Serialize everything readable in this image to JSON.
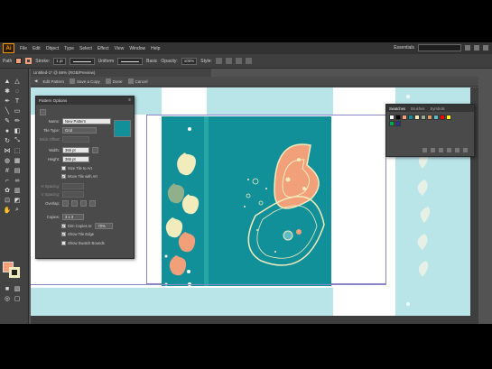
{
  "app": {
    "logo": "Ai",
    "menu": [
      "File",
      "Edit",
      "Object",
      "Type",
      "Select",
      "Effect",
      "View",
      "Window",
      "Help"
    ],
    "workspace": "Essentials",
    "accent": "#ff9a00"
  },
  "control": {
    "selection_label": "Path",
    "stroke_label": "Stroke:",
    "stroke_value": "1 pt",
    "uniform_label": "Uniform",
    "basic_label": "Basic",
    "opacity_label": "Opacity:",
    "opacity_value": "100%",
    "style_label": "Style:"
  },
  "document": {
    "tab": "Untitled-1* @ 66% (RGB/Preview)"
  },
  "pattern_bar": {
    "save_copy": "Save a Copy",
    "done": "Done",
    "cancel": "Cancel",
    "edit_pattern": "Edit Pattern"
  },
  "pattern_options": {
    "title": "Pattern Options",
    "name_label": "Name:",
    "name_value": "New Pattern",
    "tile_type_label": "Tile Type:",
    "tile_type_value": "Grid",
    "brick_offset_label": "Brick Offset:",
    "width_label": "Width:",
    "width_value": "366 pt",
    "height_label": "Height:",
    "height_value": "366 pt",
    "size_tile_label": "Size Tile to Art",
    "move_tile_label": "Move Tile with Art",
    "h_spacing_label": "H Spacing:",
    "v_spacing_label": "V Spacing:",
    "overlap_label": "Overlap:",
    "copies_label": "Copies:",
    "copies_value": "3 x 3",
    "dim_copies_label": "Dim Copies to:",
    "dim_copies_value": "70%",
    "show_tile_edge_label": "Show Tile Edge",
    "show_swatch_bounds_label": "Show Swatch Bounds"
  },
  "swatches": {
    "tabs": [
      "Swatches",
      "Brushes",
      "Symbols"
    ],
    "colors": [
      "#ffffff",
      "#000000",
      "#f2a07a",
      "#12909a",
      "#f2ecbd",
      "#8fb08a",
      "#d89a6a",
      "#5fbcc4",
      "#ff0000",
      "#ffff00",
      "#00a651",
      "#2e3192"
    ]
  },
  "colors": {
    "teal": "#12909a",
    "light_teal": "#b9e4e8",
    "peach": "#f2a07a",
    "cream": "#f2ecbd",
    "sage": "#8fb08a"
  }
}
